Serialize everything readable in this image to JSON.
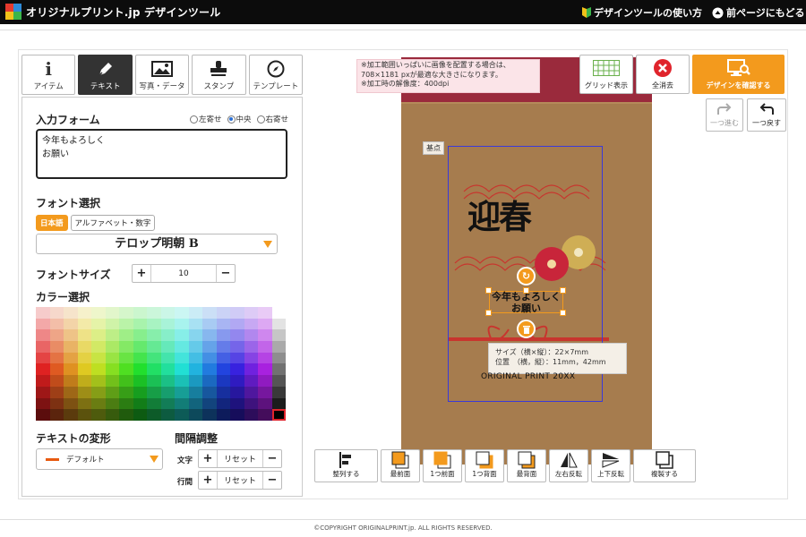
{
  "header": {
    "logo_text": "オリジナルプリント.jp デザインツール",
    "help_link": "デザインツールの使い方",
    "back_link": "前ページにもどる"
  },
  "tools": [
    {
      "label": "アイテム",
      "icon": "info-icon"
    },
    {
      "label": "テキスト",
      "icon": "pen-icon",
      "active": true
    },
    {
      "label": "写真・データ",
      "icon": "image-icon"
    },
    {
      "label": "スタンプ",
      "icon": "stamp-icon"
    },
    {
      "label": "テンプレート",
      "icon": "compass-icon"
    }
  ],
  "input_form": {
    "title": "入力フォーム",
    "align_left": "左寄せ",
    "align_center": "中央",
    "align_right": "右寄せ",
    "selected_align": "中央",
    "text_value": "今年もよろしく\nお願い"
  },
  "font": {
    "title": "フォント選択",
    "tab_japanese": "日本語",
    "tab_alpha": "アルファベット・数字",
    "selected": "テロップ明朝 B"
  },
  "font_size": {
    "title": "フォントサイズ",
    "value": "10"
  },
  "color": {
    "title": "カラー選択",
    "selected": "#000000"
  },
  "transform": {
    "title": "テキストの変形",
    "selected": "デフォルト",
    "accent": "#e85a10"
  },
  "spacing": {
    "title": "間隔調整",
    "char_label": "文字",
    "line_label": "行間",
    "reset": "リセット"
  },
  "notes": {
    "line1": "※加工範囲いっぱいに画像を配置する場合は、",
    "line2": "708×1181 pxが最適な大きさになります。",
    "line3": "※加工時の解像度：400dpi"
  },
  "top_buttons": {
    "grid": "グリッド表示",
    "clear": "全消去",
    "confirm": "デザインを確認する",
    "redo": "一つ進む",
    "undo": "一つ戻す"
  },
  "canvas": {
    "base_point": "基点",
    "greeting_title": "迎春",
    "text_line1": "今年もよろしく",
    "text_line2": "お願い",
    "size_line": "サイズ（横×縦）：22×7mm",
    "pos_line": "位置　（横，縦）：11mm，42mm",
    "brand": "ORIGINAL PRINT 20XX"
  },
  "bottom_buttons": [
    {
      "label": "整列する",
      "icon": "align-left-icon"
    },
    {
      "label": "最前面",
      "icon": "bring-front-icon"
    },
    {
      "label": "1つ前面",
      "icon": "bring-forward-icon"
    },
    {
      "label": "1つ背面",
      "icon": "send-backward-icon"
    },
    {
      "label": "最背面",
      "icon": "send-back-icon"
    },
    {
      "label": "左右反転",
      "icon": "flip-horizontal-icon"
    },
    {
      "label": "上下反転",
      "icon": "flip-vertical-icon"
    },
    {
      "label": "複製する",
      "icon": "duplicate-icon"
    }
  ],
  "footer": "©COPYRIGHT ORIGINALPRINT.jp. ALL RIGHTS RESERVED.",
  "colors": {
    "accent": "#f39a1d",
    "clear_red": "#e0242c",
    "kraft": "#a67c4e"
  }
}
